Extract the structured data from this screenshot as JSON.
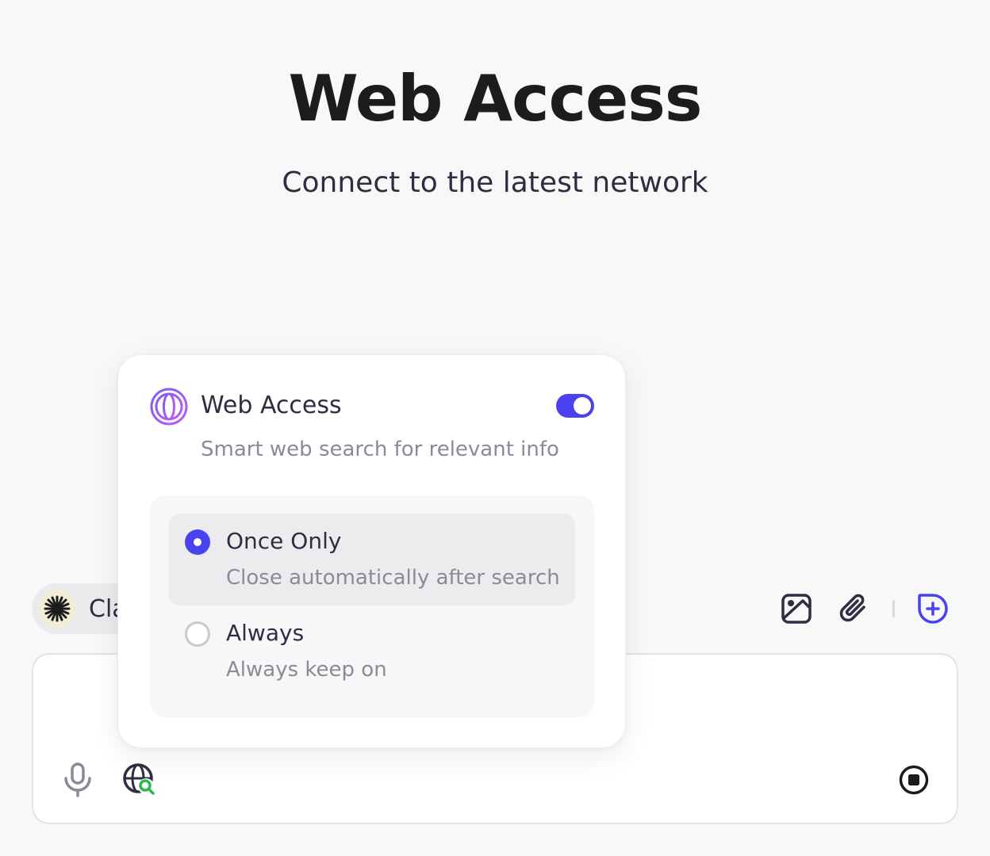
{
  "hero": {
    "title": "Web Access",
    "subtitle": "Connect to the latest network"
  },
  "model": {
    "name": "Cla",
    "icon": "starburst-icon"
  },
  "toolbar": {
    "icons": [
      "image-icon",
      "paperclip-icon",
      "plus-circle-icon"
    ]
  },
  "input": {
    "icons": [
      "microphone-icon",
      "web-search-icon",
      "stop-icon"
    ]
  },
  "popover": {
    "title": "Web Access",
    "description": "Smart web search for relevant info",
    "enabled": true,
    "icon": "globe-icon",
    "options": [
      {
        "label": "Once Only",
        "description": "Close automatically after search",
        "selected": true
      },
      {
        "label": "Always",
        "description": "Always keep on",
        "selected": false
      }
    ]
  },
  "colors": {
    "accent": "#4a42ee",
    "globe_gradient_start": "#7b5cf5",
    "globe_gradient_end": "#c05cf5",
    "search_badge": "#2db84d",
    "background": "#f8f8f9"
  }
}
